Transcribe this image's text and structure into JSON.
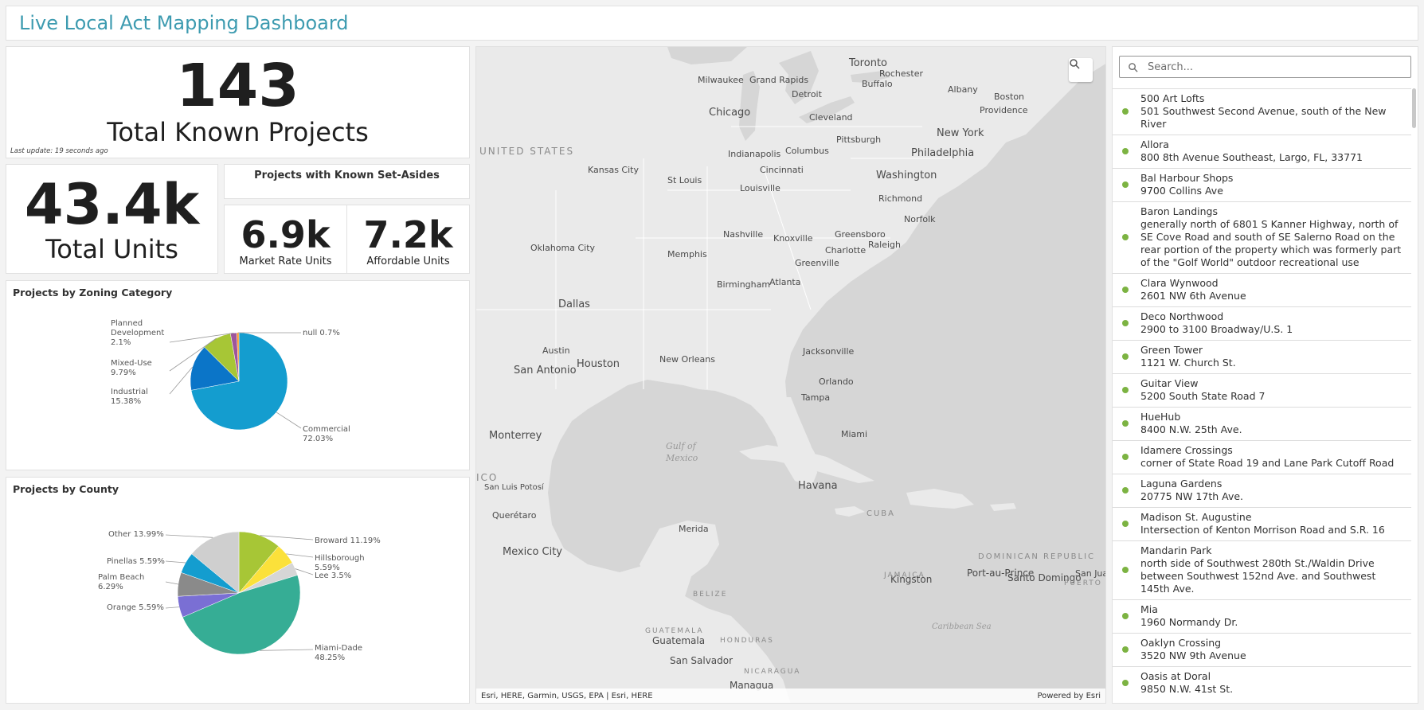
{
  "header": {
    "title": "Live Local Act Mapping Dashboard"
  },
  "total_projects": {
    "value": "143",
    "label": "Total Known Projects",
    "last_update": "Last update: 19 seconds ago"
  },
  "total_units": {
    "value": "43.4k",
    "label": "Total Units"
  },
  "set_asides": {
    "title": "Projects with Known Set-Asides",
    "market_rate": {
      "value": "6.9k",
      "label": "Market Rate Units"
    },
    "affordable": {
      "value": "7.2k",
      "label": "Affordable Units"
    }
  },
  "chart_data": [
    {
      "type": "pie",
      "title": "Projects by Zoning Category",
      "slices": [
        {
          "label": "Commercial",
          "pct_label": "72.03%",
          "value": 72.03,
          "color": "#149dcf"
        },
        {
          "label": "Industrial",
          "pct_label": "15.38%",
          "value": 15.38,
          "color": "#0b75c8"
        },
        {
          "label": "Mixed-Use",
          "pct_label": "9.79%",
          "value": 9.79,
          "color": "#a7c636"
        },
        {
          "label": "Planned Development",
          "pct_label": "2.1%",
          "value": 2.1,
          "color": "#9e559c"
        },
        {
          "label": "null",
          "pct_label": "0.7%",
          "value": 0.7,
          "color": "#fc921f"
        }
      ]
    },
    {
      "type": "pie",
      "title": "Projects by County",
      "slices": [
        {
          "label": "Broward",
          "pct_label": "11.19%",
          "value": 11.19,
          "color": "#a7c636"
        },
        {
          "label": "Hillsborough",
          "pct_label": "5.59%",
          "value": 5.59,
          "color": "#fbe13a"
        },
        {
          "label": "Lee",
          "pct_label": "3.5%",
          "value": 3.5,
          "color": "#d6d6d6"
        },
        {
          "label": "Miami-Dade",
          "pct_label": "48.25%",
          "value": 48.25,
          "color": "#36ad95"
        },
        {
          "label": "Orange",
          "pct_label": "5.59%",
          "value": 5.59,
          "color": "#7a6fd4"
        },
        {
          "label": "Palm Beach",
          "pct_label": "6.29%",
          "value": 6.29,
          "color": "#8a8a8a"
        },
        {
          "label": "Pinellas",
          "pct_label": "5.59%",
          "value": 5.59,
          "color": "#149dcf"
        },
        {
          "label": "Other",
          "pct_label": "13.99%",
          "value": 13.99,
          "color": "#cfcfcf"
        }
      ]
    }
  ],
  "map": {
    "attribution": "Esri, HERE, Garmin, USGS, EPA | Esri, HERE",
    "powered_by": "Powered by Esri",
    "water_label_gulf": [
      "Gulf of",
      "Mexico"
    ],
    "water_label_carib": "Caribbean Sea",
    "cities": [
      "Toronto",
      "Rochester",
      "Milwaukee",
      "Grand Rapids",
      "Detroit",
      "Buffalo",
      "Albany",
      "Boston",
      "Providence",
      "Chicago",
      "Cleveland",
      "New York",
      "Pittsburgh",
      "Philadelphia",
      "Indianapolis",
      "Columbus",
      "Kansas City",
      "Cincinnati",
      "Washington",
      "St Louis",
      "Louisville",
      "Richmond",
      "Norfolk",
      "Nashville",
      "Knoxville",
      "Greensboro",
      "Raleigh",
      "Charlotte",
      "Oklahoma City",
      "Memphis",
      "Greenville",
      "Birmingham",
      "Atlanta",
      "Dallas",
      "Austin",
      "Houston",
      "New Orleans",
      "Jacksonville",
      "San Antonio",
      "Orlando",
      "Tampa",
      "Miami",
      "Monterrey",
      "San Luis Potosí",
      "Querétaro",
      "Havana",
      "Merida",
      "Mexico City",
      "Kingston",
      "Port-au-Prince",
      "Santo Domingo",
      "San Jua",
      "Guatemala",
      "San Salvador",
      "Managua"
    ],
    "regions": [
      "UNITED STATES",
      "ICO",
      "CUBA",
      "DOMINICAN REPUBLIC",
      "JAMAICA",
      "PUERTO R",
      "BELIZE",
      "GUATEMALA",
      "HONDURAS",
      "NICARAGUA"
    ]
  },
  "list": {
    "search_placeholder": "Search...",
    "items": [
      {
        "name": "500 Art Lofts",
        "address": "501 Southwest Second Avenue, south of the New River"
      },
      {
        "name": "Allora",
        "address": "800 8th Avenue Southeast, Largo, FL, 33771"
      },
      {
        "name": "Bal Harbour Shops",
        "address": "9700 Collins Ave"
      },
      {
        "name": "Baron Landings",
        "address": "generally north of 6801 S Kanner Highway, north of SE Cove Road and south of SE Salerno Road on the rear portion of the property which was formerly part of the \"Golf World\" outdoor recreational use"
      },
      {
        "name": "Clara Wynwood",
        "address": "2601 NW 6th Avenue"
      },
      {
        "name": "Deco Northwood",
        "address": "2900 to 3100 Broadway/U.S. 1"
      },
      {
        "name": "Green Tower",
        "address": "1121 W. Church St."
      },
      {
        "name": "Guitar View",
        "address": "5200 South State Road 7"
      },
      {
        "name": "HueHub",
        "address": "8400 N.W. 25th Ave."
      },
      {
        "name": "Idamere Crossings",
        "address": "corner of State Road 19 and Lane Park Cutoff Road"
      },
      {
        "name": "Laguna Gardens",
        "address": "20775 NW 17th Ave."
      },
      {
        "name": "Madison St. Augustine",
        "address": "Intersection of Kenton Morrison Road and S.R. 16"
      },
      {
        "name": "Mandarin Park",
        "address": "north side of Southwest 280th St./Waldin Drive between Southwest 152nd Ave. and Southwest 145th Ave."
      },
      {
        "name": "Mia",
        "address": "1960 Normandy Dr."
      },
      {
        "name": "Oaklyn Crossing",
        "address": "3520 NW 9th Avenue"
      },
      {
        "name": "Oasis at Doral",
        "address": "9850 N.W. 41st St."
      }
    ]
  }
}
